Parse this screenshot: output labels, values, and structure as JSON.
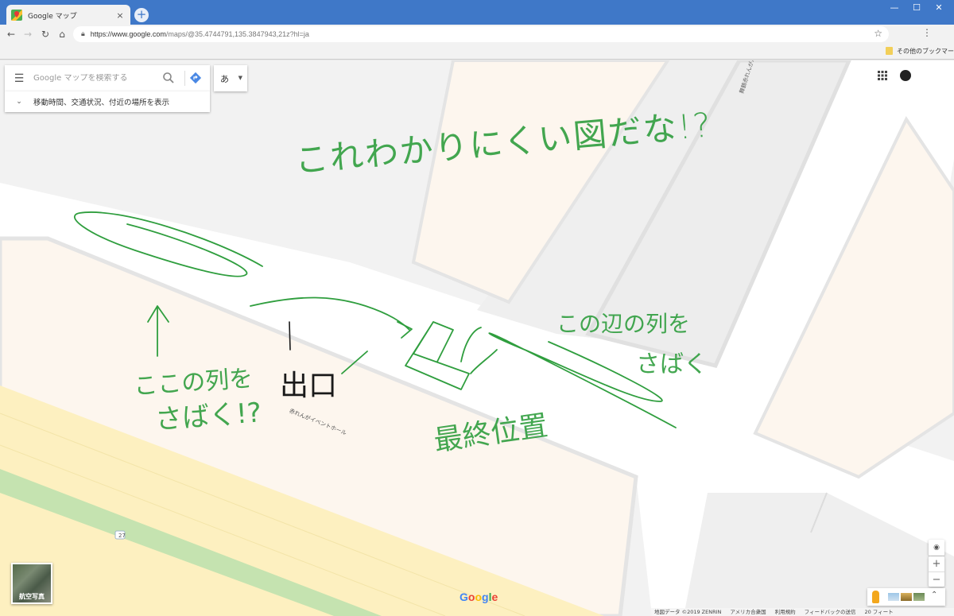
{
  "browser": {
    "tab_title": "Google マップ",
    "tab_close": "×",
    "new_tab": "+",
    "window_buttons": {
      "minimize": "—",
      "maximize": "☐",
      "close": "✕"
    },
    "url_host": "https://www.google.com",
    "url_path": "/maps/@35.4744791,135.3847943,21z?hl=ja",
    "bookmark_folder": "その他のブックマーク"
  },
  "search": {
    "placeholder": "Google マップを検索する",
    "language_button": "あ",
    "suggestion": "移動時間、交通状況、付近の場所を表示"
  },
  "map_labels": {
    "hall": "赤れんがイベントホール",
    "street": "舞鶴赤れんがパー",
    "route_number": "27"
  },
  "handwriting": {
    "title": "これわかりにくい図だな!?",
    "left_note_line1": "ここの列を",
    "left_note_line2": "さばく!?",
    "right_note_line1": "この辺の列を",
    "right_note_line2": "さばく",
    "exit": "出口",
    "final_position": "最終位置"
  },
  "satellite": {
    "label": "航空写真"
  },
  "logo": "Google",
  "controls": {
    "zoom_in": "+",
    "zoom_out": "−",
    "expand": "⌃"
  },
  "footer": {
    "map_data": "地図データ ©2019 ZENRIN",
    "country": "アメリカ合衆国",
    "terms": "利用規約",
    "feedback": "フィードバックの送信",
    "scale": "20 フィート"
  },
  "colors": {
    "chrome_blue": "#3f78c8",
    "ink_green": "#2f9e3e",
    "building_fill": "#fdf6ee",
    "road_yellow": "#fdf0c0",
    "green_strip": "#c5e3b0"
  }
}
